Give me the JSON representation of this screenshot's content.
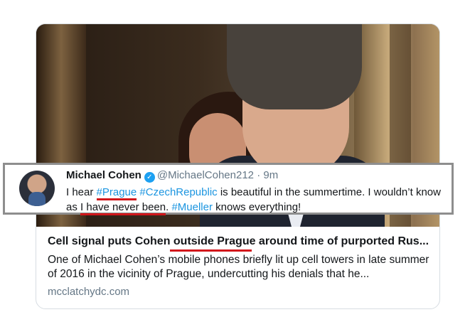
{
  "tweet": {
    "name": "Michael Cohen",
    "handle": "@MichaelCohen212",
    "separator": "·",
    "time": "9m",
    "text": {
      "part1": "I hear ",
      "hashtag_prague": "#Prague",
      "space1": " ",
      "hashtag_czech": "#CzechRepublic",
      "part2": " is beautiful in the summertime. I wouldn’t know as ",
      "never_been": "I have never been",
      "part3": ". ",
      "hashtag_mueller": "#Mueller",
      "part4": " knows everything!"
    },
    "verified_icon": "verified-badge-icon",
    "verified_glyph": "✓"
  },
  "card": {
    "title": {
      "before": "Cell signal puts Cohen ",
      "highlight": "outside Prague",
      "after": " around time of purported Rus..."
    },
    "description": "One of Michael Cohen’s mobile phones briefly lit up cell towers in late summer of 2016 in the vicinity of Prague, undercutting his denials that he...",
    "domain": "mcclatchydc.com"
  },
  "colors": {
    "link": "#1b95e0",
    "annotation_red": "#d2161b",
    "secondary_text": "#657786"
  }
}
